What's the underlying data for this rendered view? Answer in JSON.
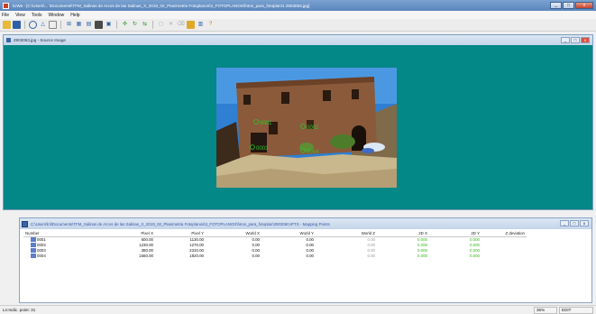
{
  "window": {
    "title": "iUWa - [C:\\Users\\... \\Documents\\TFM_Salinas de Arcos de las Salinas_X_2019_02_Planimetrie Fotoplanos\\3_FOTOPLANOS\\fotos_para_fotoplan\\1 2903063.jpg]",
    "minimize": "_",
    "maximize": "□",
    "close": "x"
  },
  "menu": [
    "File",
    "View",
    "Tools",
    "Window",
    "Help"
  ],
  "toolbar": {
    "icons": [
      "open-icon",
      "save-icon",
      "circle-icon",
      "triangle-icon",
      "rect-icon",
      "measure-icon",
      "grid-icon",
      "image-icon",
      "camera-icon",
      "export-icon",
      "points-icon",
      "rotate-icon",
      "compare-icon",
      "select-icon",
      "move-icon",
      "erase-icon",
      "tile-icon",
      "pin-icon"
    ]
  },
  "viewer": {
    "title": "2903063.jpg - Source Image",
    "buttons": [
      "_",
      "□",
      "x"
    ]
  },
  "points_panel": {
    "title": "C:\\Users\\lnl\\Documents\\TFM_Salinas de Arcos de las Salinas_X_2019_02_Planimetria Fotoplanos\\3_FOTOPLANOS\\fotos_para_fotoplan\\2903060.IPTS - Mapping Points",
    "columns": [
      "Number",
      "Pixel X",
      "Pixel Y",
      "World X",
      "World Y",
      "World Z",
      "2D X",
      "2D Y",
      "Z deviation"
    ],
    "rows": [
      [
        "0001",
        "600.00",
        "1130.00",
        "0.00",
        "0.00",
        "0.00",
        "0.000",
        "0.000",
        ""
      ],
      [
        "0002",
        "1230.00",
        "1270.00",
        "0.00",
        "0.00",
        "0.00",
        "0.000",
        "0.000",
        ""
      ],
      [
        "0003",
        "380.00",
        "2310.00",
        "0.00",
        "0.00",
        "0.00",
        "0.000",
        "0.000",
        ""
      ],
      [
        "0004",
        "1560.00",
        "1820.00",
        "0.00",
        "0.00",
        "0.00",
        "0.000",
        "0.000",
        ""
      ]
    ],
    "buttons": [
      "_",
      "□",
      "x"
    ]
  },
  "photo_labels": [
    "0001",
    "0002",
    "0003",
    "0004"
  ],
  "status": {
    "text": "Ln:Indic. point: 31",
    "zoom": "36%",
    "mode": "EDIT"
  },
  "colors": {
    "viewer_bg": "#038787",
    "point_marker": "#2cc82c",
    "value_green": "#37b51a"
  }
}
